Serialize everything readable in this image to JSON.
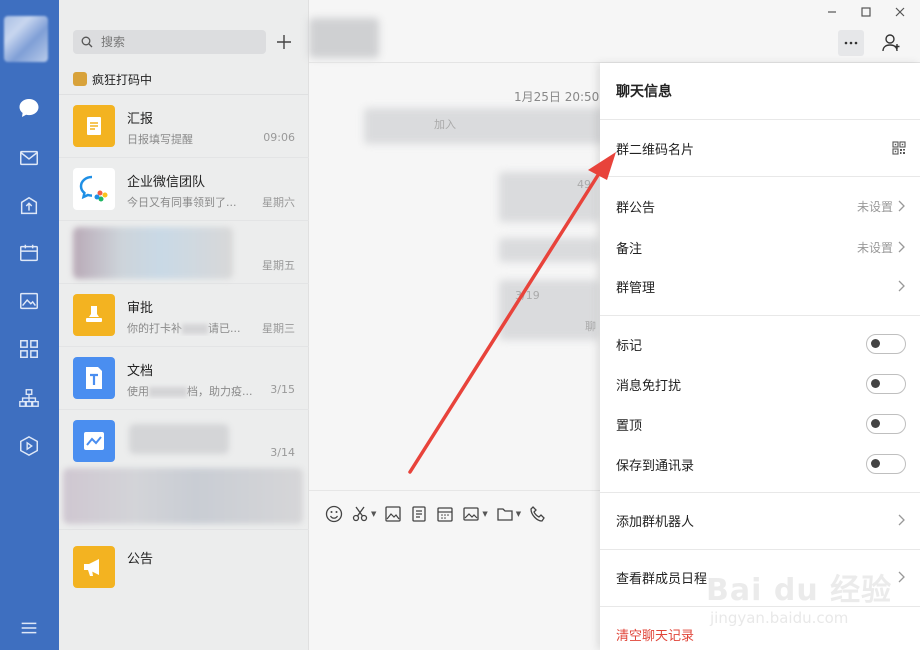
{
  "search": {
    "placeholder": "搜索"
  },
  "status": {
    "text": "疯狂打码中"
  },
  "chats": [
    {
      "title": "汇报",
      "preview": "日报填写提醒",
      "time": "09:06",
      "icon": "report-icon",
      "color": "#f3b321"
    },
    {
      "title": "企业微信团队",
      "preview": "今日又有同事领到了...",
      "time": "星期六",
      "icon": "wecom-logo-icon",
      "color": "#ffffff"
    },
    {
      "title": "",
      "preview": "",
      "time": "星期五",
      "icon": "blurred-avatar",
      "color": "#c8c8c8"
    },
    {
      "title": "审批",
      "preview": "你的打卡补",
      "preview_tail": "请已...",
      "time": "星期三",
      "icon": "approval-stamp-icon",
      "color": "#f3b321"
    },
    {
      "title": "文档",
      "preview": "使用",
      "preview_tail": "档，助力疫...",
      "time": "3/15",
      "icon": "doc-icon",
      "color": "#4a8ef0"
    },
    {
      "title": "",
      "preview": "",
      "time": "3/14",
      "icon": "chart-icon",
      "color": "#4a8ef0"
    },
    {
      "title": "公告",
      "preview": "",
      "time": "",
      "icon": "megaphone-icon",
      "color": "#f3b321"
    }
  ],
  "chat": {
    "date": "1月25日 20:50",
    "blur_snippets": [
      "加入",
      "49",
      "3/19",
      "聊"
    ]
  },
  "panel": {
    "title": "聊天信息",
    "qr_label": "群二维码名片",
    "announcement_label": "群公告",
    "announcement_value": "未设置",
    "remark_label": "备注",
    "remark_value": "未设置",
    "manage_label": "群管理",
    "toggles": [
      {
        "label": "标记",
        "on": false
      },
      {
        "label": "消息免打扰",
        "on": false
      },
      {
        "label": "置顶",
        "on": false
      },
      {
        "label": "保存到通讯录",
        "on": false
      }
    ],
    "add_bot_label": "添加群机器人",
    "schedule_label": "查看群成员日程",
    "clear_label": "清空聊天记录"
  },
  "watermark": {
    "brand": "Bai du 经验",
    "url": "jingyan.baidu.com"
  },
  "colors": {
    "nav": "#3e6fc0",
    "accent_arrow": "#e8433b",
    "danger": "#e0463a"
  }
}
